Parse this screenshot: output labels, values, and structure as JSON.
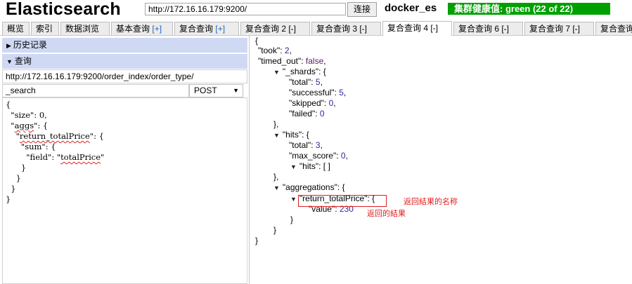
{
  "header": {
    "title": "Elasticsearch",
    "url_value": "http://172.16.16.179:9200/",
    "connect_label": "连接",
    "cluster_name": "docker_es",
    "health_text": "集群健康值: green (22 of 22)"
  },
  "tabs": [
    {
      "label": "概览"
    },
    {
      "label": "索引"
    },
    {
      "label": "数据浏览"
    },
    {
      "label": "基本查询",
      "suffix": "[+]"
    },
    {
      "label": "复合查询",
      "suffix": "[+]"
    },
    {
      "label": "复合查询 2 [-]"
    },
    {
      "label": "复合查询 3 [-]"
    },
    {
      "label": "复合查询 4 [-]",
      "active": true
    },
    {
      "label": "复合查询 6 [-]"
    },
    {
      "label": "复合查询 7 [-]"
    },
    {
      "label": "复合查询"
    }
  ],
  "left": {
    "history_label": "历史记录",
    "query_label": "查询",
    "path_value": "http://172.16.16.179:9200/order_index/order_type/",
    "endpoint_value": "_search",
    "method_value": "POST",
    "body_lines": [
      "{",
      "  \"size\": 0,",
      "  \"aggs\": {",
      "    \"return_totalPrice\": {",
      "      \"sum\": {",
      "        \"field\": \"totalPrice\"",
      "      }",
      "    }",
      "  }",
      "}"
    ]
  },
  "result": {
    "took": "2",
    "timed_out": "false",
    "shards_total": "5",
    "shards_successful": "5",
    "shards_skipped": "0",
    "shards_failed": "0",
    "hits_total": "3",
    "hits_max_score": "0",
    "hits_hits": "[ ]",
    "agg_name": "\"return_totalPrice\"",
    "agg_value": "230"
  },
  "annotations": {
    "agg_name_note": "返回結果的名称",
    "agg_value_note": "返回的結果"
  }
}
